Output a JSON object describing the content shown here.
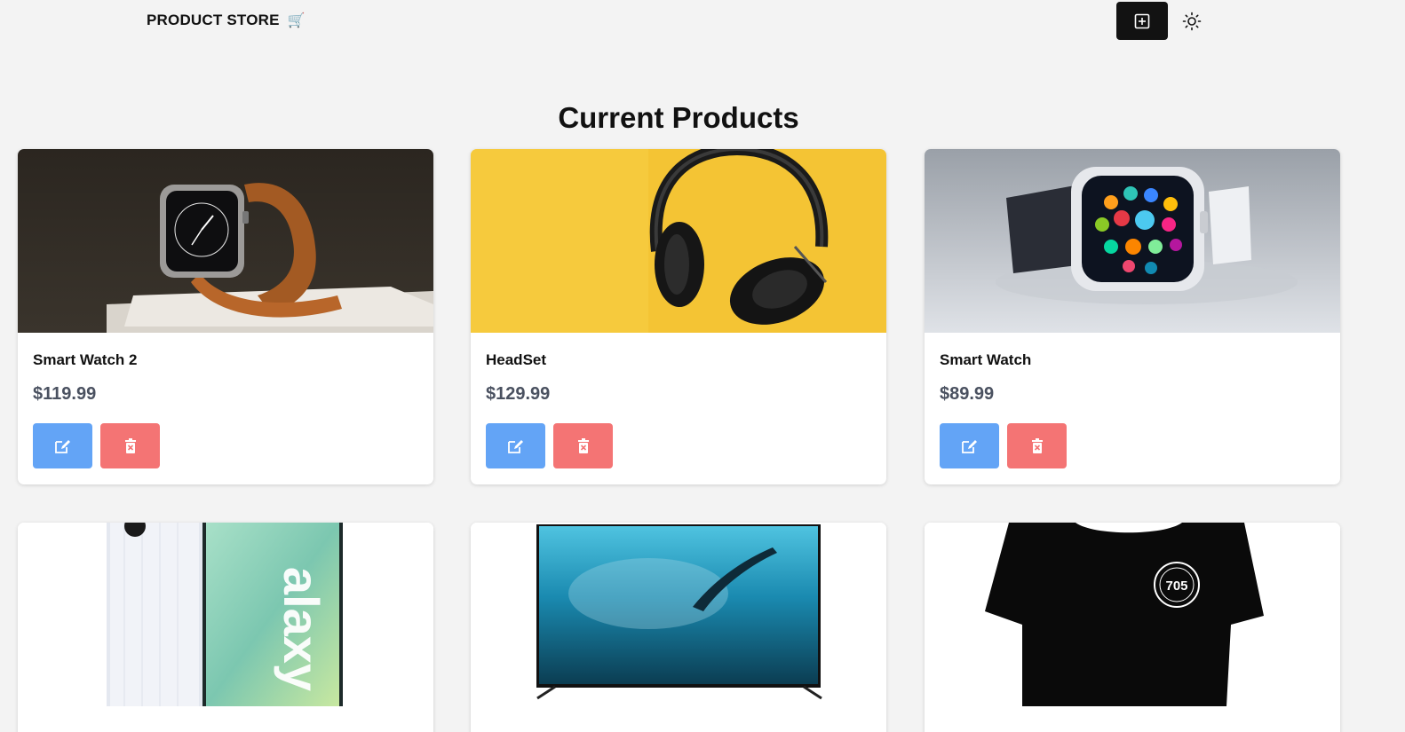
{
  "navbar": {
    "brand": "PRODUCT STORE",
    "brand_icon": "🛒",
    "create_icon": "plus-square-icon",
    "theme_icon": "sun-icon"
  },
  "page": {
    "title": "Current Products"
  },
  "products": [
    {
      "name": "Smart Watch 2",
      "price": "$119.99",
      "image": "smartwatch-leather-strap"
    },
    {
      "name": "HeadSet",
      "price": "$129.99",
      "image": "headphones-yellow"
    },
    {
      "name": "Smart Watch",
      "price": "$89.99",
      "image": "smartwatch-apps"
    },
    {
      "image": "galaxy-phone"
    },
    {
      "image": "television-underwater"
    },
    {
      "image": "black-tshirt",
      "logo_text": "705"
    }
  ],
  "colors": {
    "background": "#f3f3f3",
    "create_button": "#121212",
    "edit_button": "#63a4f6",
    "delete_button": "#f47474",
    "price_text": "#4a5160"
  }
}
